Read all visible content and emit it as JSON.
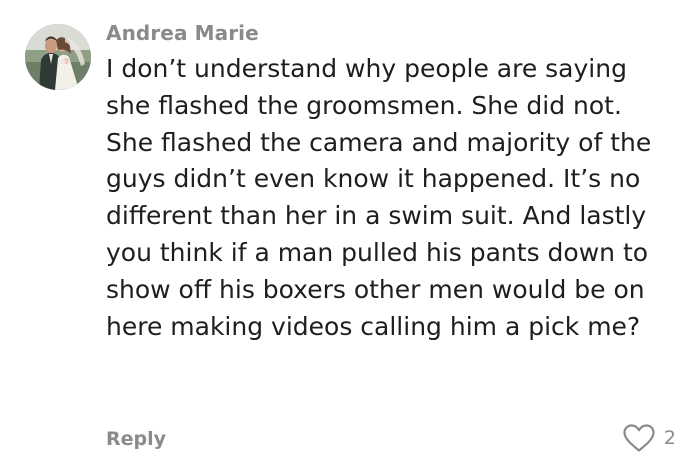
{
  "comment": {
    "author": "Andrea Marie",
    "avatar_icon": "wedding-photo-avatar",
    "text": "I don’t understand why people are saying she flashed the groomsmen. She did not. She flashed the camera and majority of the guys didn’t even know it happened. It’s no different than her in a swim suit. And lastly you think if a man pulled his pants down to show off his boxers other men would be on here making videos calling him a pick me?",
    "reply_label": "Reply",
    "like_icon": "heart-outline-icon",
    "like_count": "2"
  },
  "colors": {
    "meta_text": "#8a8a8a",
    "body_text": "#1e1e1e",
    "background": "#ffffff"
  }
}
